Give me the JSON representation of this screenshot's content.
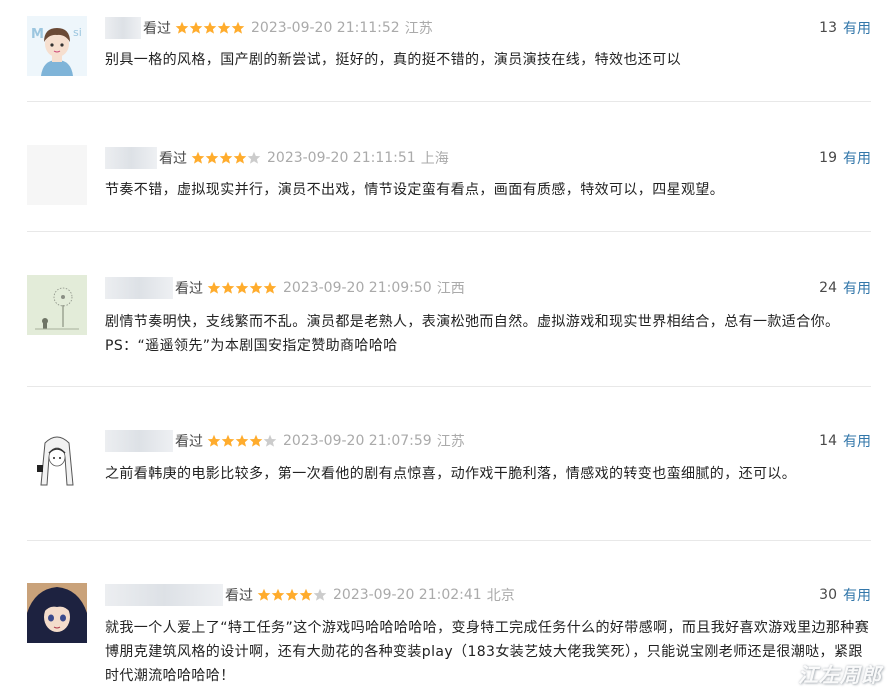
{
  "reviews": [
    {
      "watched": "看过",
      "rating": 5,
      "time": "2023-09-20 21:11:52",
      "location": "江苏",
      "votes": "13",
      "useful": "有用",
      "content": "别具一格的风格，国产剧的新尝试，挺好的，真的挺不错的，演员演技在线，特效也还可以",
      "avatar": "avatar-icon-boy"
    },
    {
      "watched": "看过",
      "rating": 4,
      "time": "2023-09-20 21:11:51",
      "location": "上海",
      "votes": "19",
      "useful": "有用",
      "content": "节奏不错，虚拟现实并行，演员不出戏，情节设定蛮有看点，画面有质感，特效可以，四星观望。",
      "avatar": "avatar-icon-blank"
    },
    {
      "watched": "看过",
      "rating": 5,
      "time": "2023-09-20 21:09:50",
      "location": "江西",
      "votes": "24",
      "useful": "有用",
      "content": "剧情节奏明快，支线繁而不乱。演员都是老熟人，表演松弛而自然。虚拟游戏和现实世界相结合，总有一款适合你。PS：“遥遥领先”为本剧国安指定赞助商哈哈哈",
      "avatar": "avatar-icon-dandelion"
    },
    {
      "watched": "看过",
      "rating": 4,
      "time": "2023-09-20 21:07:59",
      "location": "江苏",
      "votes": "14",
      "useful": "有用",
      "content": "之前看韩庚的电影比较多，第一次看他的剧有点惊喜，动作戏干脆利落，情感戏的转变也蛮细腻的，还可以。",
      "avatar": "avatar-icon-girl-sketch"
    },
    {
      "watched": "看过",
      "rating": 4,
      "time": "2023-09-20 21:02:41",
      "location": "北京",
      "votes": "30",
      "useful": "有用",
      "content": "就我一个人爱上了“特工任务”这个游戏吗哈哈哈哈哈，变身特工完成任务什么的好带感啊，而且我好喜欢游戏里边那种赛博朋克建筑风格的设计啊，还有大勋花的各种变装play（183女装艺妓大佬我笑死），只能说宝刚老师还是很潮哒，紧跟时代潮流哈哈哈哈！",
      "avatar": "avatar-icon-anime-girl"
    }
  ],
  "watermark": "江左周郎",
  "colors": {
    "link": "#3377aa",
    "star": "#ffac2d",
    "star_empty": "#cccccc",
    "meta": "#aaaaaa",
    "text": "#222222"
  }
}
